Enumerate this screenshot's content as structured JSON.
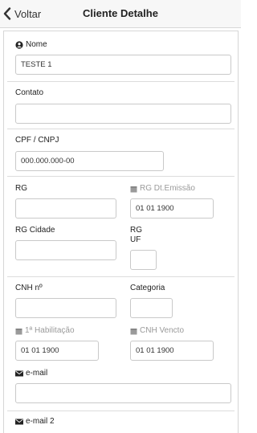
{
  "header": {
    "back_label": "Voltar",
    "title": "Cliente Detalhe"
  },
  "form": {
    "nome": {
      "label": "Nome",
      "icon": "user-circle-icon",
      "value": "TESTE 1"
    },
    "contato": {
      "label": "Contato",
      "value": ""
    },
    "cpf_cnpj": {
      "label": "CPF / CNPJ",
      "value": "000.000.000-00"
    },
    "rg": {
      "label": "RG",
      "value": ""
    },
    "rg_dt_emissao": {
      "label": "RG Dt.Emissão",
      "icon": "calendar-icon",
      "value": "01 01 1900"
    },
    "rg_cidade": {
      "label": "RG Cidade",
      "value": ""
    },
    "rg_uf": {
      "label_line1": "RG",
      "label_line2": "UF",
      "value": ""
    },
    "cnh": {
      "label": "CNH nº",
      "value": ""
    },
    "categoria": {
      "label": "Categoria",
      "value": ""
    },
    "primeira_habilitacao": {
      "label": "1ª Habilitação",
      "icon": "calendar-icon",
      "value": "01 01 1900"
    },
    "cnh_vencto": {
      "label": "CNH Vencto",
      "icon": "calendar-icon",
      "value": "01 01 1900"
    },
    "email": {
      "label": "e-mail",
      "icon": "envelope-icon",
      "value": ""
    },
    "email2": {
      "label": "e-mail 2",
      "icon": "envelope-icon"
    }
  },
  "colors": {
    "nav_background": "#f7f7f7",
    "border": "#c9c9c9",
    "muted_label": "#9a9a9a"
  }
}
